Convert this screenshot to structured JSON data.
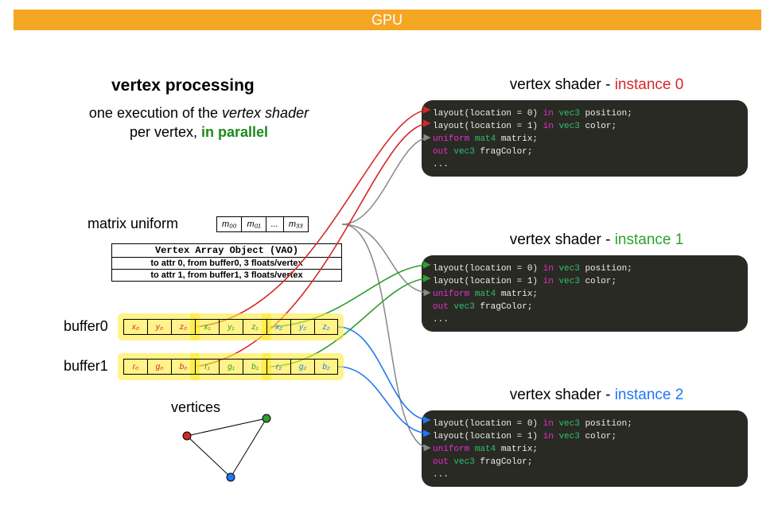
{
  "title": "GPU",
  "vp": {
    "heading": "vertex processing",
    "line1_a": "one execution of the ",
    "line1_b": "vertex shader",
    "line2_a": "per vertex, ",
    "line2_b": "in parallel"
  },
  "matrix": {
    "label": "matrix uniform",
    "cells": [
      "m₀₀",
      "m₀₁",
      "...",
      "m₃₃"
    ]
  },
  "vao": {
    "title": "Vertex Array Object (VAO)",
    "rows": [
      "to attr 0, from buffer0, 3 floats/vertex",
      "to attr 1, from buffer1, 3 floats/vertex"
    ]
  },
  "buffers": {
    "buf0_label": "buffer0",
    "buf1_label": "buffer1",
    "buf0": [
      "x₀",
      "y₀",
      "z₀",
      "x₁",
      "y₁",
      "z₁",
      "x₂",
      "y₂",
      "z₂"
    ],
    "buf1": [
      "r₀",
      "g₀",
      "b₀",
      "r₁",
      "g₁",
      "b₁",
      "r₂",
      "g₂",
      "b₂"
    ],
    "colors0": [
      "c-red",
      "c-red",
      "c-red",
      "c-green",
      "c-green",
      "c-green",
      "c-blue",
      "c-blue",
      "c-blue"
    ],
    "colors1": [
      "c-red",
      "c-red",
      "c-red",
      "c-green",
      "c-green",
      "c-green",
      "c-blue",
      "c-blue",
      "c-blue"
    ]
  },
  "vertices_label": "vertices",
  "shaders": {
    "prefix": "vertex shader - ",
    "instances": [
      "instance 0",
      "instance 1",
      "instance 2"
    ],
    "code": {
      "l1a": "layout(location = 0) ",
      "l1b": "in ",
      "l1c": "vec3",
      "l1d": " position;",
      "l2a": "layout(location = 1) ",
      "l2b": "in ",
      "l2c": "vec3",
      "l2d": " color;",
      "l3a": "uniform ",
      "l3b": "mat4",
      "l3c": " matrix;",
      "l4a": "out ",
      "l4b": "vec3",
      "l4c": " fragColor;",
      "l5": "..."
    }
  },
  "colors": {
    "accent": "#f5a623",
    "red": "#d62728",
    "green": "#2ca02c",
    "blue": "#1f77f4",
    "gray": "#888888"
  }
}
